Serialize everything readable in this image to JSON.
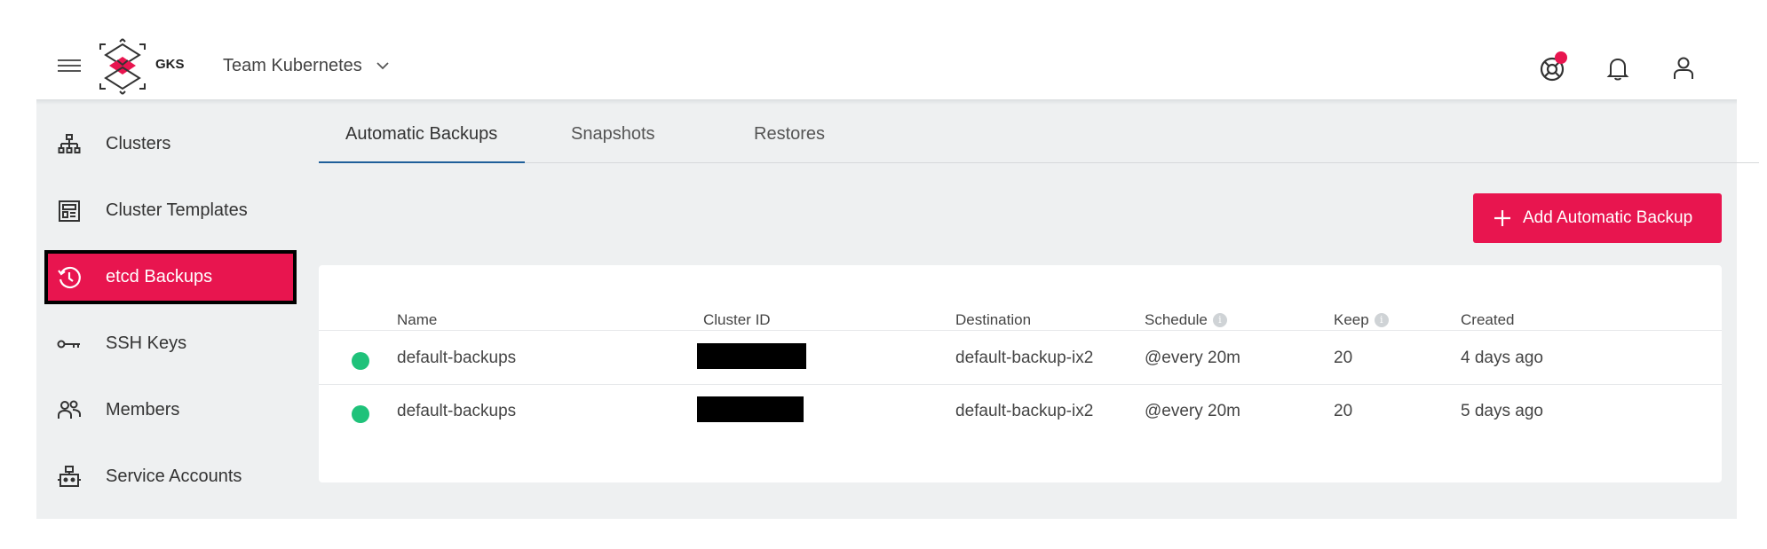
{
  "header": {
    "logo_text": "GKS",
    "team": "Team Kubernetes"
  },
  "sidebar": {
    "items": [
      {
        "label": "Clusters",
        "icon": "sitemap-icon"
      },
      {
        "label": "Cluster Templates",
        "icon": "template-icon"
      },
      {
        "label": "etcd Backups",
        "icon": "history-icon",
        "active": true
      },
      {
        "label": "SSH Keys",
        "icon": "key-icon"
      },
      {
        "label": "Members",
        "icon": "members-icon"
      },
      {
        "label": "Service Accounts",
        "icon": "robot-icon"
      }
    ]
  },
  "tabs": [
    "Automatic Backups",
    "Snapshots",
    "Restores"
  ],
  "actions": {
    "add_label": "Add Automatic Backup"
  },
  "table": {
    "headers": {
      "name": "Name",
      "cluster_id": "Cluster ID",
      "destination": "Destination",
      "schedule": "Schedule",
      "keep": "Keep",
      "created": "Created"
    },
    "rows": [
      {
        "name": "default-backups",
        "destination": "default-backup-ix2",
        "schedule": "@every 20m",
        "keep": "20",
        "created": "4 days ago"
      },
      {
        "name": "default-backups",
        "destination": "default-backup-ix2",
        "schedule": "@every 20m",
        "keep": "20",
        "created": "5 days ago"
      }
    ]
  },
  "colors": {
    "accent": "#e8154f",
    "status_ok": "#1fc27a",
    "tab_indicator": "#1f5f9a"
  }
}
